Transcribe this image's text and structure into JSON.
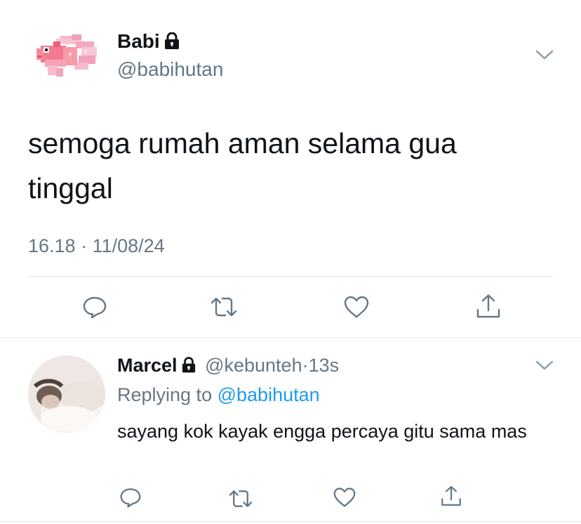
{
  "tweet": {
    "name": "Babi",
    "handle": "@babihutan",
    "text": "semoga rumah aman selama gua tinggal",
    "timestamp": "16.18 · 11/08/24",
    "protected_icon": "lock-icon",
    "avatar_icon": "pixel-goldfish"
  },
  "reply": {
    "name": "Marcel",
    "handle": "@kebunteh",
    "separator": "·",
    "time": "13s",
    "replying_prefix": "Replying to",
    "replying_handle": "@babihutan",
    "text": "sayang kok kayak engga percaya gitu sama mas",
    "protected_icon": "lock-icon"
  },
  "actions": [
    "reply-icon",
    "retweet-icon",
    "like-icon",
    "share-icon"
  ],
  "colors": {
    "text": "#0f1419",
    "muted": "#657786",
    "link": "#1d9bf0",
    "divider": "#e1e8ed"
  }
}
